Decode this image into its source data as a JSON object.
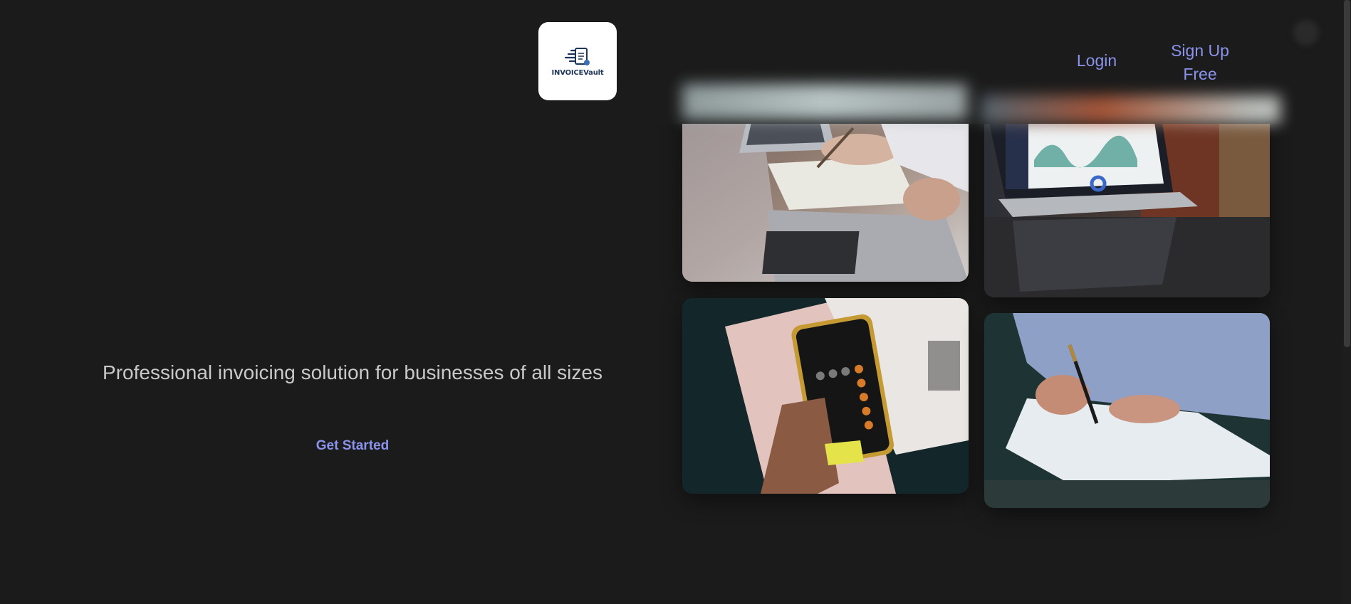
{
  "header": {
    "logo_text": "INVOICEVault",
    "login_label": "Login",
    "signup_label_line1": "Sign Up",
    "signup_label_line2": "Free"
  },
  "hero": {
    "tagline": "Professional invoicing solution for businesses of all sizes",
    "cta_label": "Get Started"
  },
  "gallery": {
    "images": [
      {
        "name": "laptop-meeting-photo"
      },
      {
        "name": "analytics-dashboard-photo"
      },
      {
        "name": "calculator-phone-photo"
      },
      {
        "name": "signing-document-photo"
      }
    ]
  },
  "colors": {
    "background": "#1b1b1b",
    "accent": "#8b93ec",
    "tagline": "#c9c9c9",
    "logo_text": "#1d3557"
  }
}
